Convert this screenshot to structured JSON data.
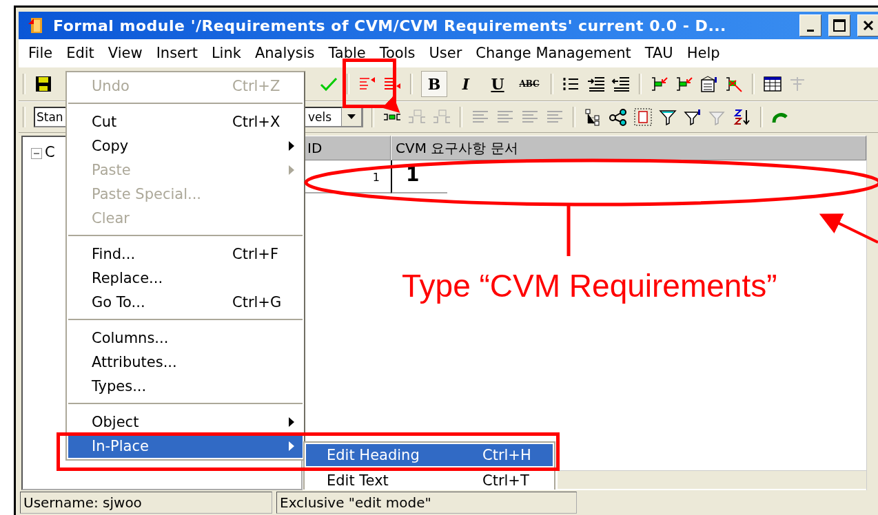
{
  "window": {
    "title": "Formal module '/Requirements of CVM/CVM Requirements' current 0.0 - D..."
  },
  "menu_bar": [
    "File",
    "Edit",
    "View",
    "Insert",
    "Link",
    "Analysis",
    "Table",
    "Tools",
    "User",
    "Change Management",
    "TAU",
    "Help"
  ],
  "format_buttons": [
    {
      "label": "B",
      "selected": true
    },
    {
      "label": "I",
      "selected": false
    },
    {
      "label": "U",
      "selected": false
    },
    {
      "label": "ABC",
      "selected": false
    }
  ],
  "style_combo": {
    "value": "Stan"
  },
  "levels_combo": {
    "value": "vels"
  },
  "tree": [
    {
      "label": "C",
      "expanded": true
    }
  ],
  "table": {
    "columns": [
      "ID",
      "CVM 요구사항 문서"
    ],
    "rows": [
      {
        "id": "1",
        "heading": "1"
      }
    ]
  },
  "edit_menu": [
    {
      "kind": "item",
      "label": "Undo",
      "shortcut": "Ctrl+Z",
      "disabled": true,
      "submenu": false,
      "selected": false
    },
    {
      "kind": "separator"
    },
    {
      "kind": "item",
      "label": "Cut",
      "shortcut": "Ctrl+X",
      "disabled": false,
      "submenu": false,
      "selected": false
    },
    {
      "kind": "item",
      "label": "Copy",
      "disabled": false,
      "submenu": true,
      "selected": false
    },
    {
      "kind": "item",
      "label": "Paste",
      "disabled": true,
      "submenu": true,
      "selected": false
    },
    {
      "kind": "item",
      "label": "Paste Special...",
      "disabled": true,
      "submenu": false,
      "selected": false
    },
    {
      "kind": "item",
      "label": "Clear",
      "disabled": true,
      "submenu": false,
      "selected": false
    },
    {
      "kind": "separator"
    },
    {
      "kind": "item",
      "label": "Find...",
      "shortcut": "Ctrl+F",
      "disabled": false,
      "submenu": false,
      "selected": false
    },
    {
      "kind": "item",
      "label": "Replace...",
      "disabled": false,
      "submenu": false,
      "selected": false
    },
    {
      "kind": "item",
      "label": "Go To...",
      "shortcut": "Ctrl+G",
      "disabled": false,
      "submenu": false,
      "selected": false
    },
    {
      "kind": "separator"
    },
    {
      "kind": "item",
      "label": "Columns...",
      "disabled": false,
      "submenu": false,
      "selected": false
    },
    {
      "kind": "item",
      "label": "Attributes...",
      "disabled": false,
      "submenu": false,
      "selected": false
    },
    {
      "kind": "item",
      "label": "Types...",
      "disabled": false,
      "submenu": false,
      "selected": false
    },
    {
      "kind": "separator"
    },
    {
      "kind": "item",
      "label": "Object",
      "disabled": false,
      "submenu": true,
      "selected": false
    },
    {
      "kind": "item",
      "label": "In-Place",
      "disabled": false,
      "submenu": true,
      "selected": true
    }
  ],
  "in_place_submenu": [
    {
      "label": "Edit Heading",
      "shortcut": "Ctrl+H",
      "selected": true
    },
    {
      "label": "Edit Text",
      "shortcut": "Ctrl+T",
      "selected": false
    }
  ],
  "status_bar": [
    "Username: sjwoo",
    "Exclusive \"edit mode\""
  ],
  "annotation": {
    "callout": "Type “CVM Requirements”"
  }
}
